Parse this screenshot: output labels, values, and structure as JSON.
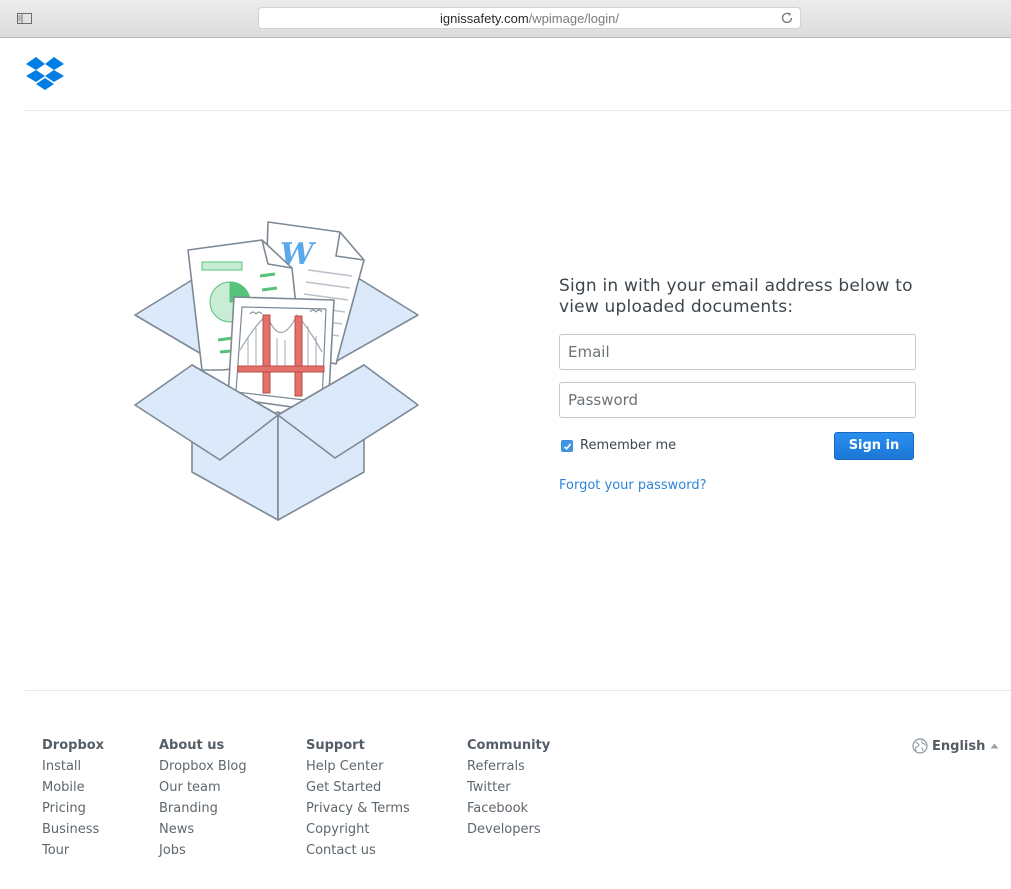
{
  "browser": {
    "url_host": "ignissafety.com",
    "url_path": "/wpimage/login/"
  },
  "form": {
    "title": "Sign in with your email address below to view uploaded documents:",
    "email_placeholder": "Email",
    "password_placeholder": "Password",
    "remember_label": "Remember me",
    "remember_checked": true,
    "signin_label": "Sign in",
    "forgot_label": "Forgot your password?"
  },
  "footer": {
    "columns": [
      {
        "heading": "Dropbox",
        "links": [
          "Install",
          "Mobile",
          "Pricing",
          "Business",
          "Tour"
        ]
      },
      {
        "heading": "About us",
        "links": [
          "Dropbox Blog",
          "Our team",
          "Branding",
          "News",
          "Jobs"
        ]
      },
      {
        "heading": "Support",
        "links": [
          "Help Center",
          "Get Started",
          "Privacy & Terms",
          "Copyright",
          "Contact us"
        ]
      },
      {
        "heading": "Community",
        "links": [
          "Referrals",
          "Twitter",
          "Facebook",
          "Developers"
        ]
      }
    ],
    "language": "English"
  },
  "icons": {
    "logo": "dropbox-logo-icon",
    "globe": "globe-icon",
    "caret": "caret-up-icon",
    "reload": "reload-icon",
    "sidebar": "sidebar-toggle-icon"
  },
  "colors": {
    "brand_blue": "#007ee5",
    "button_blue": "#1f7fdf",
    "link_blue": "#2d86d9",
    "box_fill": "#dbe9fa",
    "box_stroke": "#7d8a96"
  }
}
